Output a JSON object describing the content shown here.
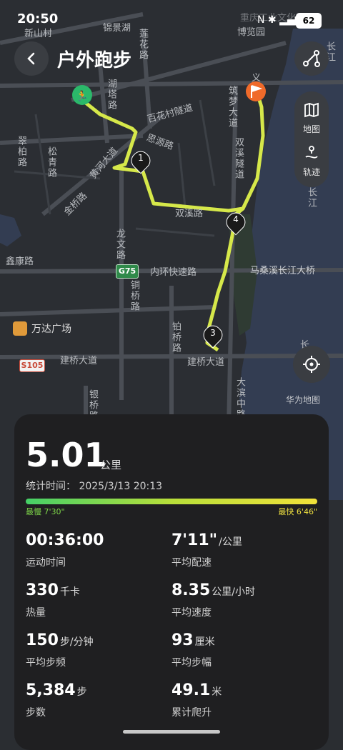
{
  "status_bar": {
    "time": "20:50",
    "battery": "62"
  },
  "header": {
    "title": "户外跑步"
  },
  "side_panel": {
    "map_label": "地图",
    "track_label": "轨迹"
  },
  "map": {
    "labels": {
      "xinshan": "新山村",
      "jinghu": "锦景湖",
      "lianhua": "莲花路",
      "huhu": "湖塔路",
      "baihua": "百花村隧道",
      "siyuan": "思源路",
      "cuibai": "翠柏路",
      "songyi": "松青路",
      "huanghe": "黄河大道",
      "jingui": "金桥路",
      "shuangxi": "双溪路",
      "longwen": "龙文路",
      "xinkang": "鑫康路",
      "neihuan": "内环快速路",
      "tongqiao": "铜桥路",
      "masang": "马桑溪长江大桥",
      "wanda": "万达广场",
      "bochan": "铂桥路",
      "jianqiao": "建桥大道",
      "jianqiao2": "建桥大道",
      "yinqiao": "银桥路",
      "dabin": "大滨中路",
      "zhumeng": "筑梦大道",
      "shuangxi_tunnel": "双溪隧道",
      "bowuguan": "博览园",
      "industry": "重庆工业文化",
      "changjiang": "长江",
      "changjiang2": "长江",
      "yi": "义",
      "chang": "长"
    },
    "shields": {
      "g75": "G75",
      "s105": "S105"
    },
    "markers": {
      "km1": "1",
      "km3": "3",
      "km4": "4"
    },
    "credit": "华为地图"
  },
  "summary": {
    "distance": "5.01",
    "distance_unit": "公里",
    "stat_time_label": "统计时间：",
    "stat_time": "2025/3/13 20:13",
    "pace_slowest": "最慢 7'30\"",
    "pace_fastest": "最快 6'46\""
  },
  "metrics": [
    {
      "value": "00:36:00",
      "unit": "",
      "label": "运动时间"
    },
    {
      "value": "7'11\"",
      "unit": "/公里",
      "label": "平均配速"
    },
    {
      "value": "330",
      "unit": "千卡",
      "label": "热量"
    },
    {
      "value": "8.35",
      "unit": "公里/小时",
      "label": "平均速度"
    },
    {
      "value": "150",
      "unit": "步/分钟",
      "label": "平均步频"
    },
    {
      "value": "93",
      "unit": "厘米",
      "label": "平均步幅"
    },
    {
      "value": "5,384",
      "unit": "步",
      "label": "步数"
    },
    {
      "value": "49.1",
      "unit": "米",
      "label": "累计爬升"
    }
  ]
}
